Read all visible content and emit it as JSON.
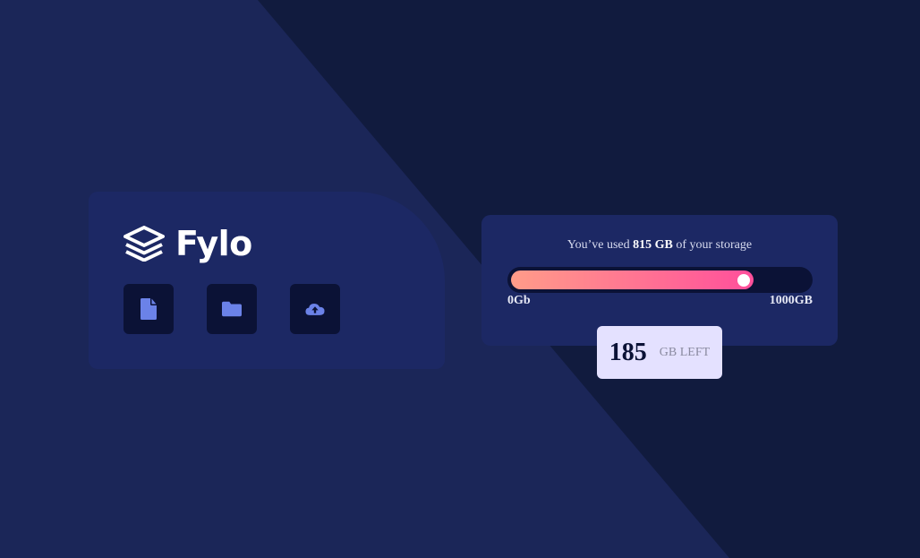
{
  "brand": {
    "name": "Fylo",
    "actions": [
      {
        "icon": "document-icon"
      },
      {
        "icon": "folder-icon"
      },
      {
        "icon": "cloud-upload-icon"
      }
    ]
  },
  "storage": {
    "used_prefix": "You’ve used ",
    "used_value": "815 GB",
    "used_suffix": " of your storage",
    "used_gb": 815,
    "capacity_gb": 1000,
    "scale_min_label": "0Gb",
    "scale_max_label": "1000GB",
    "remaining_value": "185",
    "remaining_unit": "GB LEFT"
  },
  "colors": {
    "background": "#111b3e",
    "card": "#1c2864",
    "icon_tile": "#0b1236",
    "icon": "#6b82e8",
    "gradient_start": "#ff9c89",
    "gradient_end": "#ff4f9b",
    "badge": "#e4e1ff"
  }
}
